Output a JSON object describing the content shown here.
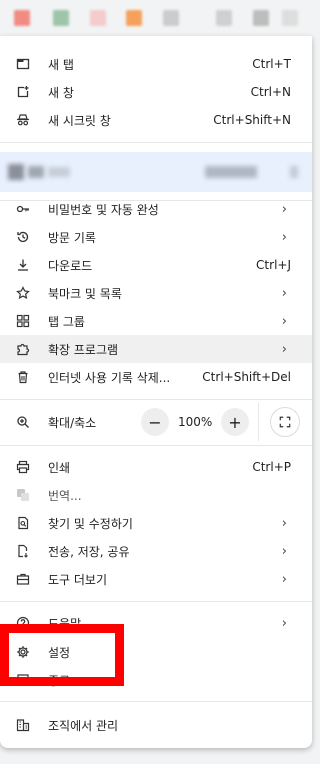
{
  "menu": {
    "new_tab": {
      "label": "새 탭",
      "shortcut": "Ctrl+T",
      "icon": "new-tab-icon"
    },
    "new_window": {
      "label": "새 창",
      "shortcut": "Ctrl+N",
      "icon": "new-window-icon"
    },
    "incognito": {
      "label": "새 시크릿 창",
      "shortcut": "Ctrl+Shift+N",
      "icon": "incognito-icon"
    },
    "passwords": {
      "label": "비밀번호 및 자동 완성",
      "icon": "key-icon"
    },
    "history": {
      "label": "방문 기록",
      "icon": "history-icon"
    },
    "downloads": {
      "label": "다운로드",
      "shortcut": "Ctrl+J",
      "icon": "download-icon"
    },
    "bookmarks": {
      "label": "북마크 및 목록",
      "icon": "star-icon"
    },
    "tab_groups": {
      "label": "탭 그룹",
      "icon": "tab-groups-icon"
    },
    "extensions": {
      "label": "확장 프로그램",
      "icon": "puzzle-icon"
    },
    "clear_data": {
      "label": "인터넷 사용 기록 삭제...",
      "shortcut": "Ctrl+Shift+Del",
      "icon": "trash-icon"
    },
    "zoom": {
      "label": "확대/축소",
      "minus": "−",
      "value": "100%",
      "plus": "+",
      "icon": "zoom-icon"
    },
    "print": {
      "label": "인쇄",
      "shortcut": "Ctrl+P",
      "icon": "print-icon"
    },
    "translate": {
      "label": "번역...",
      "icon": "translate-icon"
    },
    "find_edit": {
      "label": "찾기 및 수정하기",
      "icon": "find-icon"
    },
    "cast_save_share": {
      "label": "전송, 저장, 공유",
      "icon": "save-share-icon"
    },
    "more_tools": {
      "label": "도구 더보기",
      "icon": "toolbox-icon"
    },
    "help": {
      "label": "도움말",
      "icon": "help-icon"
    },
    "settings": {
      "label": "설정",
      "icon": "gear-icon"
    },
    "exit": {
      "label": "종료",
      "icon": "exit-icon"
    },
    "managed": {
      "label": "조직에서 관리",
      "icon": "building-icon"
    }
  },
  "colors": {
    "highlight_box": "#ff0000",
    "hover_row": "#f0f0f0",
    "profile_row": "#e8f0fe"
  }
}
